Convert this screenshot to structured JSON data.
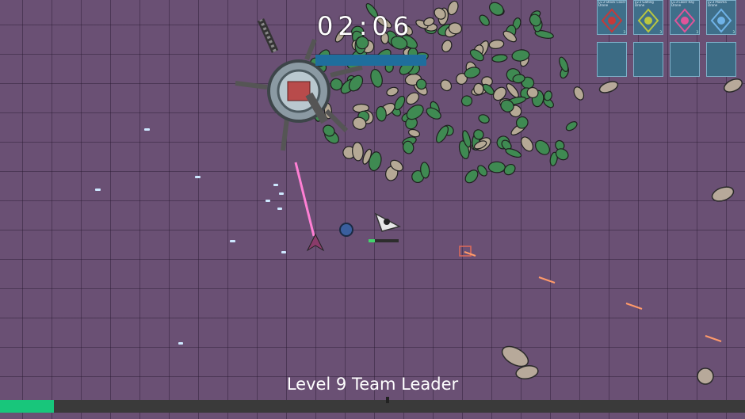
{
  "hud": {
    "timer": "02:06",
    "level_title": "Level 9 Team Leader",
    "xp_progress": 0.072,
    "boss_hp": 1.0
  },
  "drone_slots": [
    {
      "label": "Lv.3 Shock Cover\nDrone",
      "icon": "shock-cover-drone-icon",
      "accent": "#c43a3a",
      "level": "3"
    },
    {
      "label": "Lv.3 Gatling Drone",
      "icon": "gatling-drone-icon",
      "accent": "#b9c640",
      "level": "3"
    },
    {
      "label": "Lv.3 Laser Ray\nDrone",
      "icon": "laser-ray-drone-icon",
      "accent": "#e0559a",
      "level": "3"
    },
    {
      "label": "Lv.3 Plasma\nDrone",
      "icon": "plasma-drone-icon",
      "accent": "#6fb3e8",
      "level": "3"
    },
    {
      "label": "",
      "icon": "empty-slot",
      "accent": "#3c6b84"
    },
    {
      "label": "",
      "icon": "empty-slot",
      "accent": "#3c6b84"
    },
    {
      "label": "",
      "icon": "empty-slot",
      "accent": "#3c6b84"
    },
    {
      "label": "",
      "icon": "empty-slot",
      "accent": "#3c6b84"
    }
  ],
  "colors": {
    "floor": "#6a5074",
    "xp_fill": "#18c67b",
    "boss_hp_fill": "#1f6e9d",
    "enemy_green": "#3f8a52",
    "laser_pink": "#ff7fd4",
    "bullet_blue": "#cde8ff"
  }
}
